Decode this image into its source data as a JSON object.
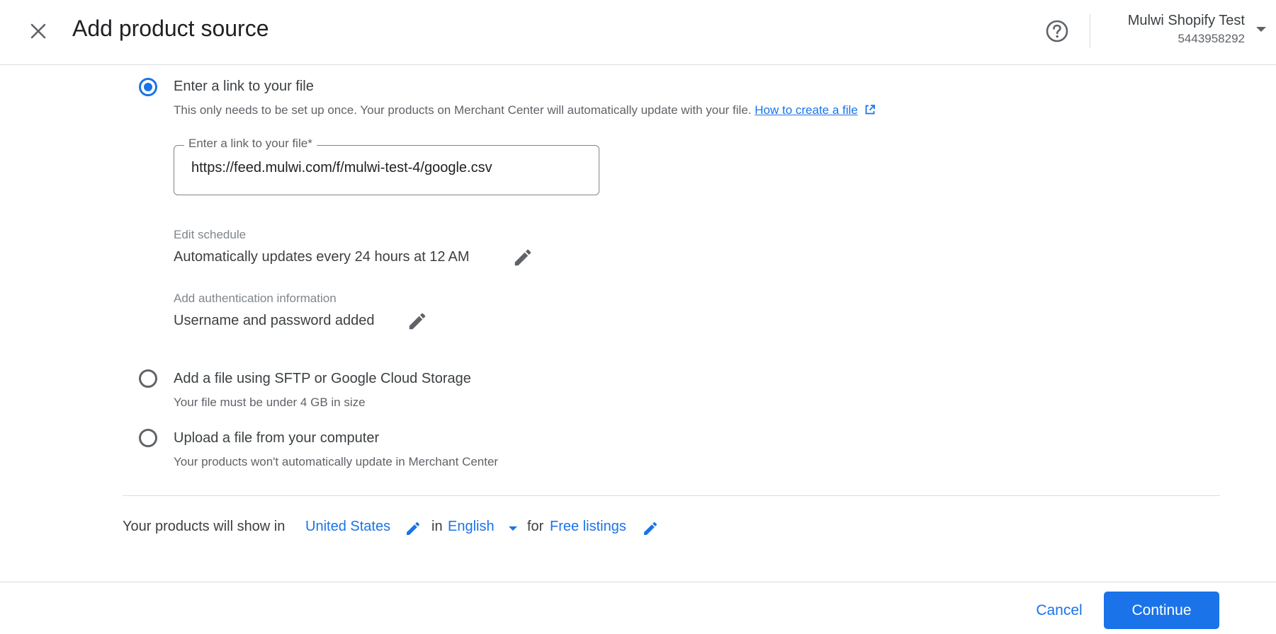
{
  "header": {
    "title": "Add product source",
    "account_name": "Mulwi Shopify Test",
    "account_id": "5443958292"
  },
  "options": [
    {
      "label": "Enter a link to your file",
      "selected": true,
      "description": "This only needs to be set up once. Your products on Merchant Center will automatically update with your file.",
      "help_link": "How to create a file"
    },
    {
      "label": "Add a file using SFTP or Google Cloud Storage",
      "selected": false,
      "description": "Your file must be under 4 GB in size"
    },
    {
      "label": "Upload a file from your computer",
      "selected": false,
      "description": "Your products won't automatically update in Merchant Center"
    }
  ],
  "link_field": {
    "label": "Enter a link to your file*",
    "value": "https://feed.mulwi.com/f/mulwi-test-4/google.csv"
  },
  "schedule": {
    "label": "Edit schedule",
    "value": "Automatically updates every 24 hours at 12 AM"
  },
  "auth": {
    "label": "Add authentication information",
    "value": "Username and password added"
  },
  "show_row": {
    "prefix": "Your products will show in",
    "country": "United States",
    "in_word": "in",
    "language": "English",
    "for_word": "for",
    "destination": "Free listings"
  },
  "footer": {
    "cancel": "Cancel",
    "continue": "Continue"
  },
  "colors": {
    "accent": "#1a73e8",
    "text": "#3c4043",
    "muted": "#5f6368"
  }
}
